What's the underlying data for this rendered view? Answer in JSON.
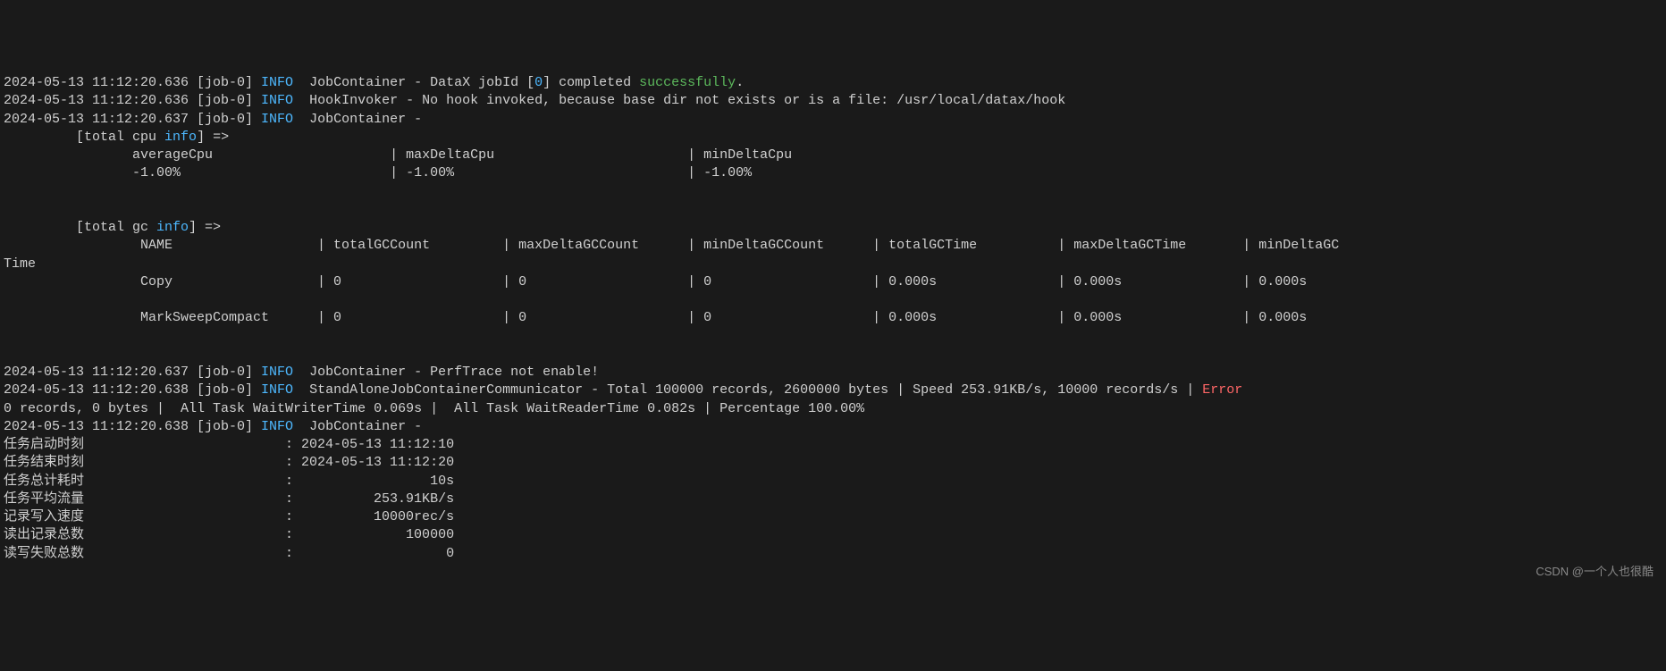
{
  "lines": [
    {
      "ts": "2024-05-13 11:12:20.636",
      "job": "[job-0]",
      "level": "INFO",
      "prefix": "JobContainer - DataX jobId [",
      "jobId": "0",
      "suffix": "] completed ",
      "status": "successfully",
      "tail": "."
    },
    {
      "ts": "2024-05-13 11:12:20.636",
      "job": "[job-0]",
      "level": "INFO",
      "msg": "HookInvoker - No hook invoked, because base dir not exists or is a file: /usr/local/datax/hook"
    },
    {
      "ts": "2024-05-13 11:12:20.637",
      "job": "[job-0]",
      "level": "INFO",
      "msg": "JobContainer - "
    }
  ],
  "cpuInfo": {
    "header": "[total cpu ",
    "keyword": "info",
    "headerTail": "] => ",
    "cols": {
      "c1": "averageCpu",
      "c2": "maxDeltaCpu",
      "c3": "minDeltaCpu"
    },
    "vals": {
      "v1": "-1.00%",
      "v2": "-1.00%",
      "v3": "-1.00%"
    }
  },
  "gcInfo": {
    "header": "[total gc ",
    "keyword": "info",
    "headerTail": "] => ",
    "cols": {
      "c0": "NAME",
      "c1": "totalGCCount",
      "c2": "maxDeltaGCCount",
      "c3": "minDeltaGCCount",
      "c4": "totalGCTime",
      "c5": "maxDeltaGCTime",
      "c6": "minDeltaGC"
    },
    "wrap": "Time",
    "rows": [
      {
        "name": "Copy",
        "v1": "0",
        "v2": "0",
        "v3": "0",
        "v4": "0.000s",
        "v5": "0.000s",
        "v6": "0.000s"
      },
      {
        "name": "MarkSweepCompact",
        "v1": "0",
        "v2": "0",
        "v3": "0",
        "v4": "0.000s",
        "v5": "0.000s",
        "v6": "0.000s"
      }
    ]
  },
  "tail": [
    {
      "ts": "2024-05-13 11:12:20.637",
      "job": "[job-0]",
      "level": "INFO",
      "msg": "JobContainer - PerfTrace not enable!"
    },
    {
      "ts": "2024-05-13 11:12:20.638",
      "job": "[job-0]",
      "level": "INFO",
      "msg": "StandAloneJobContainerCommunicator - Total 100000 records, 2600000 bytes | Speed 253.91KB/s, 10000 records/s | ",
      "err": "Error"
    },
    {
      "raw": "0 records, 0 bytes |  All Task WaitWriterTime 0.069s |  All Task WaitReaderTime 0.082s | Percentage 100.00%"
    },
    {
      "ts": "2024-05-13 11:12:20.638",
      "job": "[job-0]",
      "level": "INFO",
      "msg": "JobContainer - "
    }
  ],
  "summary": [
    {
      "label": "任务启动时刻",
      "value": "2024-05-13 11:12:10"
    },
    {
      "label": "任务结束时刻",
      "value": "2024-05-13 11:12:20"
    },
    {
      "label": "任务总计耗时",
      "value": "10s"
    },
    {
      "label": "任务平均流量",
      "value": "253.91KB/s"
    },
    {
      "label": "记录写入速度",
      "value": "10000rec/s"
    },
    {
      "label": "读出记录总数",
      "value": "100000"
    },
    {
      "label": "读写失败总数",
      "value": "0"
    }
  ],
  "watermark": "CSDN @一个人也很酷"
}
